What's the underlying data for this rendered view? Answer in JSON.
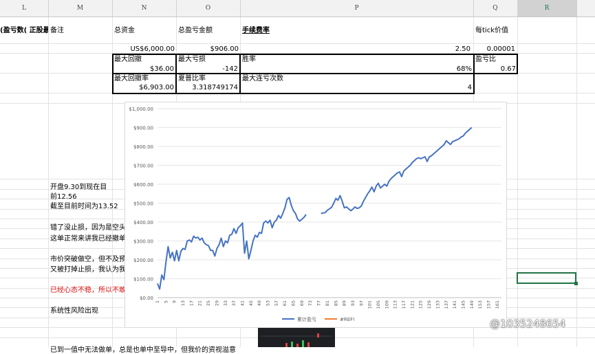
{
  "columns": [
    "L",
    "M",
    "N",
    "O",
    "P",
    "Q",
    "R"
  ],
  "selected_column": "R",
  "headers": {
    "L": "(盈亏数( 正股最",
    "M": "备注",
    "N": "总资金",
    "O": "总盈亏金额",
    "P": "手续费率",
    "Q": "每tick价值"
  },
  "values_row": {
    "N": "US$6,000.00",
    "O": "$906.00",
    "P": "2.50",
    "Q": "0.00001"
  },
  "stats": {
    "max_drawdown_label": "最大回撤",
    "max_drawdown_value": "$36.00",
    "max_loss_label": "最大亏损",
    "max_loss_value": "-142",
    "win_rate_label": "胜率",
    "win_rate_value": "68%",
    "pl_ratio_label": "盈亏比",
    "pl_ratio_value": "0.67",
    "max_dd_rate_label": "最大回撤率",
    "max_dd_rate_value": "$6,903.00",
    "sharpe_label": "夏普比率",
    "sharpe_value": "3.318749174",
    "max_consec_loss_label": "最大连亏次数",
    "max_consec_loss_value": "4"
  },
  "notes": [
    {
      "text": "开盘9.30到现在目",
      "color": "#000000"
    },
    {
      "text": "前12.56",
      "color": "#000000"
    },
    {
      "text": "截至目前时间为13.52",
      "color": "#000000"
    },
    {
      "text": "错了没止损，因为是空头",
      "color": "#000000"
    },
    {
      "text": "这单正常来讲我已经撤单",
      "color": "#000000"
    },
    {
      "text": "市价突破做空，但不及预",
      "color": "#000000"
    },
    {
      "text": "又被打掉止损，我认为我",
      "color": "#000000"
    },
    {
      "text": "已经心态不稳，所以不敢",
      "color": "#e01010"
    },
    {
      "text": "系统性风险出现",
      "color": "#000000"
    },
    {
      "text": "已到一值中无法做单，总是也单中至导中，但我价的资视溢意",
      "color": "#000000"
    }
  ],
  "watermark": "@1035248654",
  "chart_data": {
    "type": "line",
    "ylim": [
      0,
      1000
    ],
    "y_ticks": [
      "$0.00",
      "$100.00",
      "$200.00",
      "$300.00",
      "$400.00",
      "$500.00",
      "$600.00",
      "$700.00",
      "$800.00",
      "$900.00",
      "$1,000.00"
    ],
    "x_ticks": [
      "1",
      "5",
      "9",
      "13",
      "17",
      "21",
      "25",
      "29",
      "33",
      "37",
      "41",
      "45",
      "49",
      "53",
      "57",
      "61",
      "65",
      "69",
      "73",
      "77",
      "81",
      "85",
      "89",
      "93",
      "97",
      "101",
      "105",
      "109",
      "113",
      "117",
      "121",
      "125",
      "129",
      "133",
      "137",
      "141",
      "145",
      "149",
      "153",
      "157",
      "161"
    ],
    "grid": true,
    "legend_position": "bottom",
    "series": [
      {
        "name": "累计盈亏",
        "color": "#4472c4",
        "segments": [
          {
            "start_x": 1,
            "values": [
              75,
              45,
              120,
              95,
              190,
              270,
              210,
              240,
              195,
              250,
              195,
              245,
              260,
              255,
              300,
              305,
              295,
              325,
              315,
              320,
              305,
              315,
              290,
              280,
              275,
              250,
              250,
              220,
              260,
              280,
              315,
              270,
              300,
              290,
              330,
              335,
              365,
              340,
              370,
              380,
              395,
              235,
              300,
              205,
              250,
              300,
              330,
              320,
              345,
              340,
              395,
              405,
              395,
              410,
              370,
              400,
              410,
              435,
              420,
              445,
              475,
              520,
              530,
              490,
              460,
              445,
              415,
              405,
              415,
              425,
              440
            ]
          },
          {
            "start_x": 78,
            "values": [
              445,
              448,
              450,
              462,
              470,
              478,
              500,
              525,
              515,
              540,
              510,
              475,
              480,
              470,
              460,
              468,
              480,
              472,
              475,
              485,
              510,
              530,
              550,
              565,
              585,
              560,
              590,
              605,
              580,
              590,
              600,
              590,
              615,
              630,
              640,
              650,
              660,
              665,
              640,
              670,
              680,
              690,
              700,
              715,
              725,
              735,
              740,
              735,
              740,
              745,
              720,
              745,
              750,
              760,
              770,
              780,
              790,
              800,
              810,
              830,
              820,
              810,
              825,
              830,
              835,
              840,
              850,
              855,
              870,
              880,
              890,
              900
            ]
          }
        ]
      },
      {
        "name": "#REF!",
        "color": "#ed7d31",
        "segments": []
      }
    ]
  }
}
